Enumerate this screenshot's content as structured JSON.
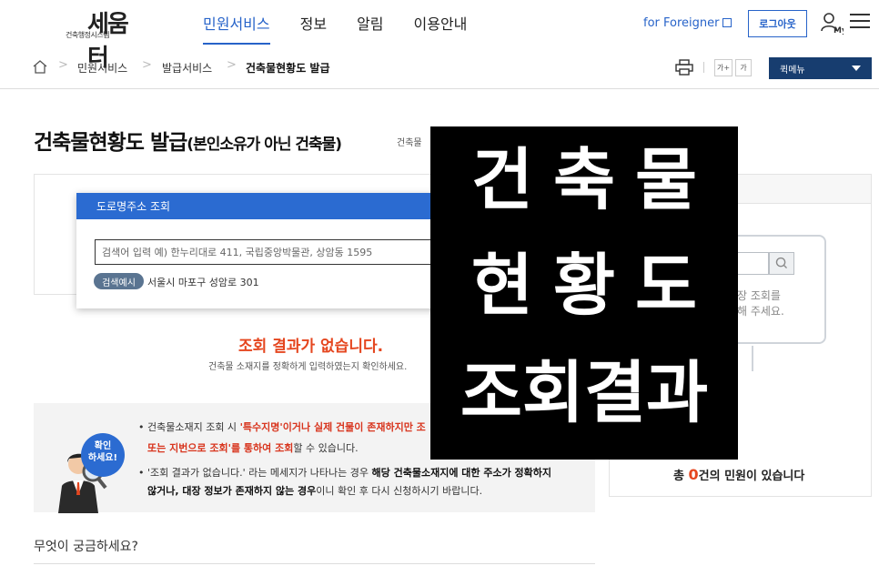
{
  "header": {
    "logo_sub": "건축행정시스템",
    "logo_main": "세움터",
    "nav": [
      {
        "label": "민원서비스",
        "active": true
      },
      {
        "label": "정보",
        "active": false
      },
      {
        "label": "알림",
        "active": false
      },
      {
        "label": "이용안내",
        "active": false
      }
    ],
    "foreigner_link": "for Foreigner",
    "logout_label": "로그아웃",
    "my_label": "My"
  },
  "breadcrumb": {
    "items": [
      "민원서비스",
      "발급서비스",
      "건축물현황도 발급"
    ],
    "font_plus": "가+",
    "font_minus": "가",
    "quick_menu": "퀵메뉴"
  },
  "page": {
    "title": "건축물현황도 발급",
    "title_sub": "(본인소유가 아닌 건축물)",
    "title_note": "건축물"
  },
  "search": {
    "popup_title": "도로명주소 조회",
    "placeholder": "검색어 입력 예) 한누리대로 411, 국립중앙박물관, 상암동 1595",
    "example_badge": "검색예시",
    "example_text": "서울시 마포구 성암로 301"
  },
  "result": {
    "no_result": "조회 결과가 없습니다.",
    "no_result_sub": "건축물 소재지를 정확하게 입력하였는지 확인하세요."
  },
  "notice": {
    "badge_line1": "확인",
    "badge_line2": "하세요!",
    "line1_pre": "• 건축물소재지 조회 시 ",
    "line1_red": "'특수지명'이거나 실제 건물이 존재하지만 조",
    "line2_red": "또는 지번으로 조회'를 통하여 조회",
    "line2_post": "할 수 있습니다.",
    "line3_pre": "• '조회 결과가 없습니다.' 라는 메세지가 나타나는 경우 ",
    "line3_bold": "해당 건축물소재지에 대한 주소가 정확하지",
    "line4_bold": "않거나, 대장 정보가 존재하지 않는 경우",
    "line4_post": "이니 확인 후 다시 신청하시기 바랍니다."
  },
  "faq": {
    "title": "무엇이 궁금하세요?"
  },
  "right_panel": {
    "hint_line1": "장 조회를",
    "hint_line2": "해 주세요.",
    "total_pre": "총 ",
    "total_count": "0",
    "total_post": "건의 민원이 있습니다"
  },
  "overlay": {
    "line1": "건축물",
    "line2": "현황도",
    "line3": "조회결과"
  },
  "colors": {
    "accent": "#2763c9",
    "popup_header": "#2b6bd1",
    "error": "#e5461f",
    "quick_menu_bg": "#173d6f"
  },
  "icons": [
    "home-icon",
    "chevron-right-icon",
    "print-icon",
    "external-link-icon",
    "user-my-icon",
    "hamburger-menu-icon",
    "caret-down-icon",
    "search-icon",
    "magnifier-person-illustration"
  ]
}
